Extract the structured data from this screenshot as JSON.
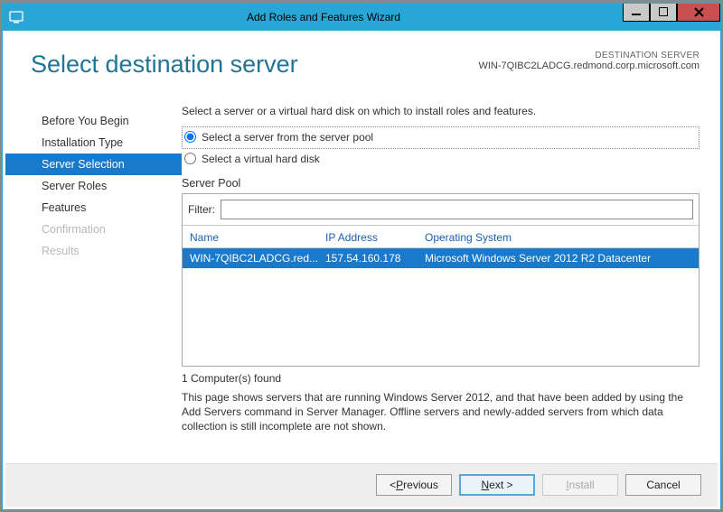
{
  "window": {
    "title": "Add Roles and Features Wizard"
  },
  "header": {
    "title": "Select destination server",
    "dest_label": "DESTINATION SERVER",
    "dest_server": "WIN-7QIBC2LADCG.redmond.corp.microsoft.com"
  },
  "nav": {
    "items": [
      {
        "label": "Before You Begin",
        "state": "normal"
      },
      {
        "label": "Installation Type",
        "state": "normal"
      },
      {
        "label": "Server Selection",
        "state": "active"
      },
      {
        "label": "Server Roles",
        "state": "normal"
      },
      {
        "label": "Features",
        "state": "normal"
      },
      {
        "label": "Confirmation",
        "state": "disabled"
      },
      {
        "label": "Results",
        "state": "disabled"
      }
    ]
  },
  "main": {
    "intro": "Select a server or a virtual hard disk on which to install roles and features.",
    "radio1": "Select a server from the server pool",
    "radio2": "Select a virtual hard disk",
    "radio_selected": 0,
    "pool_label": "Server Pool",
    "filter_label": "Filter:",
    "filter_value": "",
    "columns": {
      "name": "Name",
      "ip": "IP Address",
      "os": "Operating System"
    },
    "rows": [
      {
        "name": "WIN-7QIBC2LADCG.red...",
        "ip": "157.54.160.178",
        "os": "Microsoft Windows Server 2012 R2 Datacenter",
        "selected": true
      }
    ],
    "count": "1 Computer(s) found",
    "explain": "This page shows servers that are running Windows Server 2012, and that have been added by using the Add Servers command in Server Manager. Offline servers and newly-added servers from which data collection is still incomplete are not shown."
  },
  "footer": {
    "previous_pre": "< ",
    "previous_u": "P",
    "previous_post": "revious",
    "next_u": "N",
    "next_post": "ext >",
    "install_u": "I",
    "install_post": "nstall",
    "cancel": "Cancel"
  }
}
